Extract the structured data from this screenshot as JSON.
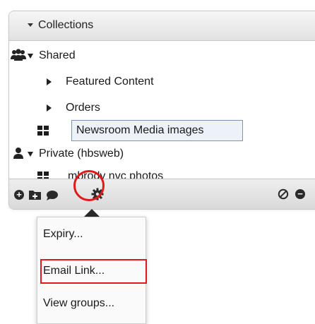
{
  "panel": {
    "title": "Collections"
  },
  "tree": {
    "shared": {
      "label": "Shared",
      "children": [
        {
          "label": "Featured Content"
        },
        {
          "label": "Orders"
        }
      ],
      "collection": "Newsroom Media images"
    },
    "private": {
      "label": "Private (hbsweb)",
      "collection": "mbrody nvc photos"
    }
  },
  "footer": {
    "icons": [
      "add-icon",
      "add-folder-icon",
      "comment-icon",
      "gear-icon",
      "cancel-icon",
      "remove-icon"
    ]
  },
  "menu": {
    "items": [
      {
        "label": "Expiry..."
      },
      {
        "label": "Email Link..."
      },
      {
        "label": "View groups..."
      }
    ],
    "highlighted": "Email Link..."
  },
  "colors": {
    "highlight": "#e01a1a",
    "selection_border": "#7c93b8",
    "selection_fill": "#edf2fa"
  }
}
